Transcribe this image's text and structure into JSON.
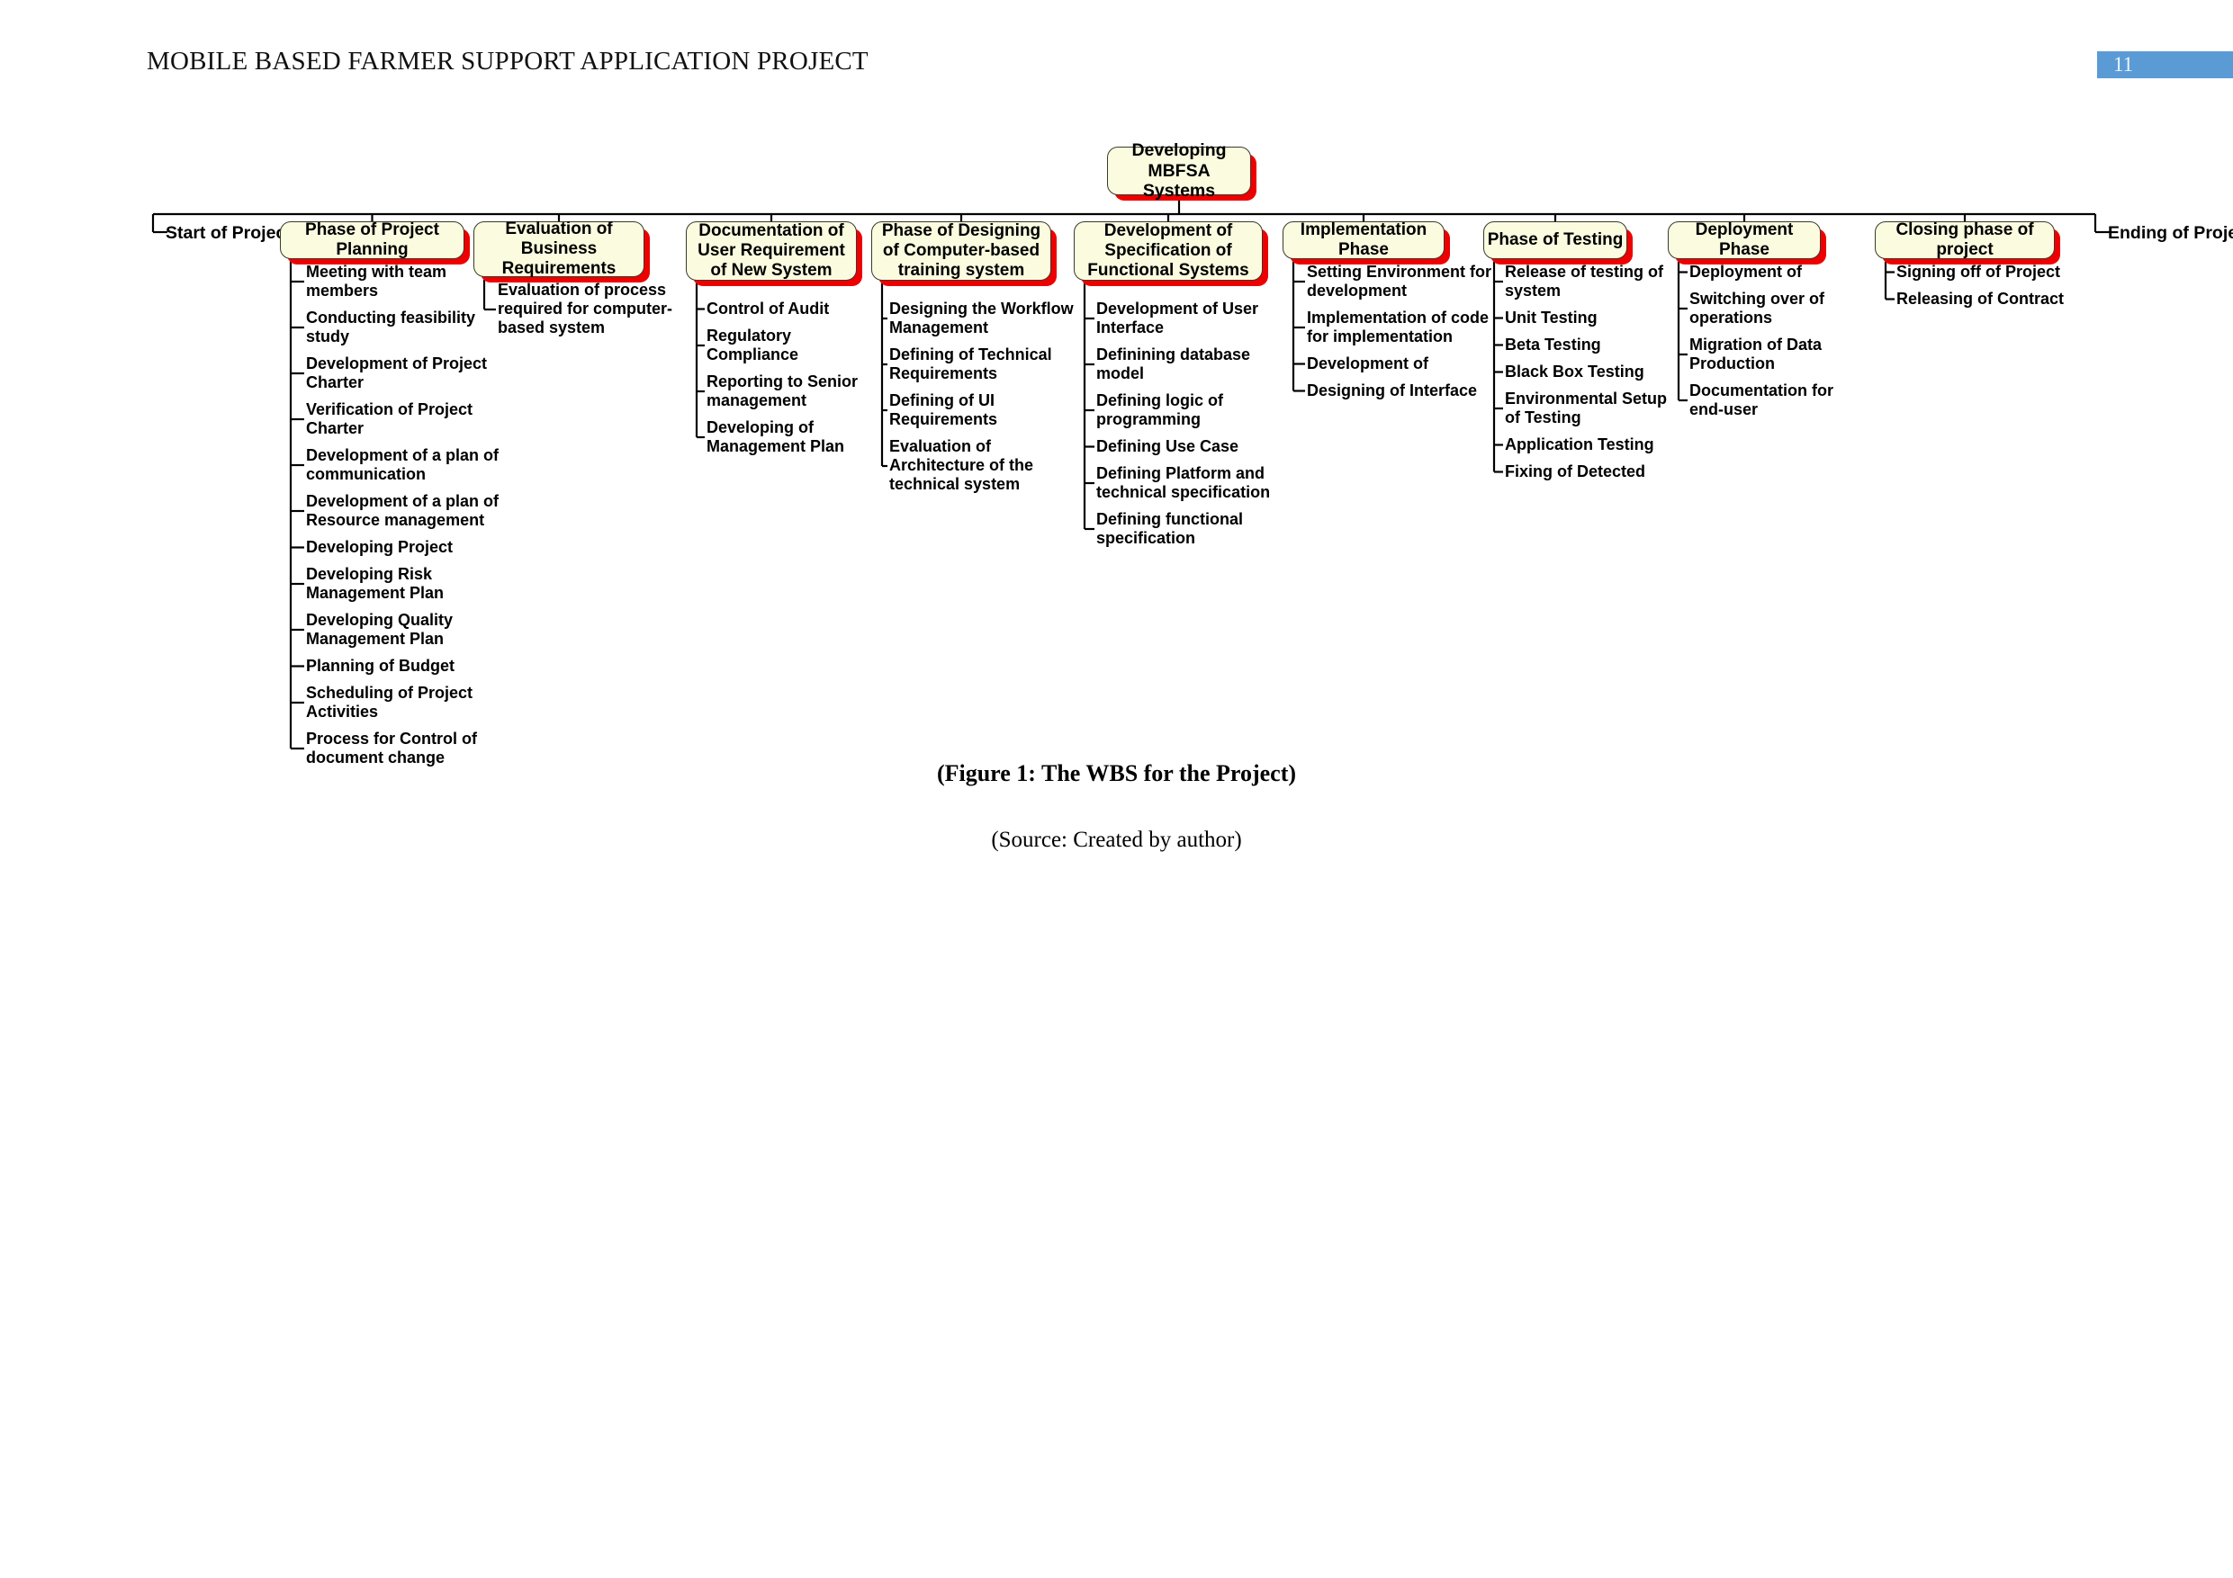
{
  "document": {
    "header_title": "MOBILE BASED FARMER SUPPORT APPLICATION PROJECT",
    "page_number": "11",
    "page_number_color": "#5b9bd5",
    "figure_caption": "(Figure 1: The WBS for the Project)",
    "source_caption": "(Source: Created by author)"
  },
  "diagram": {
    "node_fill_color": "#fbfbe0",
    "node_border_color": "#3a3a2e",
    "node_shadow_color": "#ee0000",
    "connector_color": "#000000",
    "root": {
      "label": "Developing MBFSA Systems"
    },
    "start_label": "Start of Project",
    "end_label": "Ending of Project",
    "phases": [
      {
        "label": "Phase of Project Planning",
        "tasks": [
          "Meeting with team members",
          "Conducting feasibility study",
          "Development of Project Charter",
          "Verification of Project Charter",
          "Development of a plan of communication",
          "Development of a plan of Resource management",
          "Developing Project",
          "Developing Risk Management Plan",
          "Developing Quality Management Plan",
          "Planning of Budget",
          "Scheduling of Project Activities",
          "Process for Control of document change"
        ]
      },
      {
        "label": "Evaluation of Business Requirements",
        "tasks": [
          "Evaluation of process required for computer-based system"
        ]
      },
      {
        "label": "Documentation of User Requirement of New System",
        "tasks": [
          "Control of Audit",
          "Regulatory Compliance",
          "Reporting to Senior management",
          "Developing of Management Plan"
        ]
      },
      {
        "label": "Phase of Designing of Computer-based training system",
        "tasks": [
          "Designing the Workflow Management",
          "Defining of Technical Requirements",
          "Defining of UI Requirements",
          "Evaluation of Architecture of the technical system"
        ]
      },
      {
        "label": "Development of Specification of Functional Systems",
        "tasks": [
          "Development of User Interface",
          "Definining database model",
          "Defining logic of programming",
          "Defining Use Case",
          "Defining Platform and technical specification",
          "Defining functional specification"
        ]
      },
      {
        "label": "Implementation Phase",
        "tasks": [
          "Setting Environment for development",
          "Implementation of code for implementation",
          "Development of",
          "Designing of Interface"
        ]
      },
      {
        "label": "Phase of Testing",
        "tasks": [
          "Release of testing of system",
          "Unit Testing",
          "Beta Testing",
          "Black Box Testing",
          "Environmental Setup of Testing",
          "Application Testing",
          "Fixing of Detected"
        ]
      },
      {
        "label": "Deployment Phase",
        "tasks": [
          "Deployment of",
          "Switching over of operations",
          "Migration of Data Production",
          "Documentation for end-user"
        ]
      },
      {
        "label": "Closing phase of project",
        "tasks": [
          "Signing off of Project",
          "Releasing of Contract"
        ]
      }
    ]
  }
}
